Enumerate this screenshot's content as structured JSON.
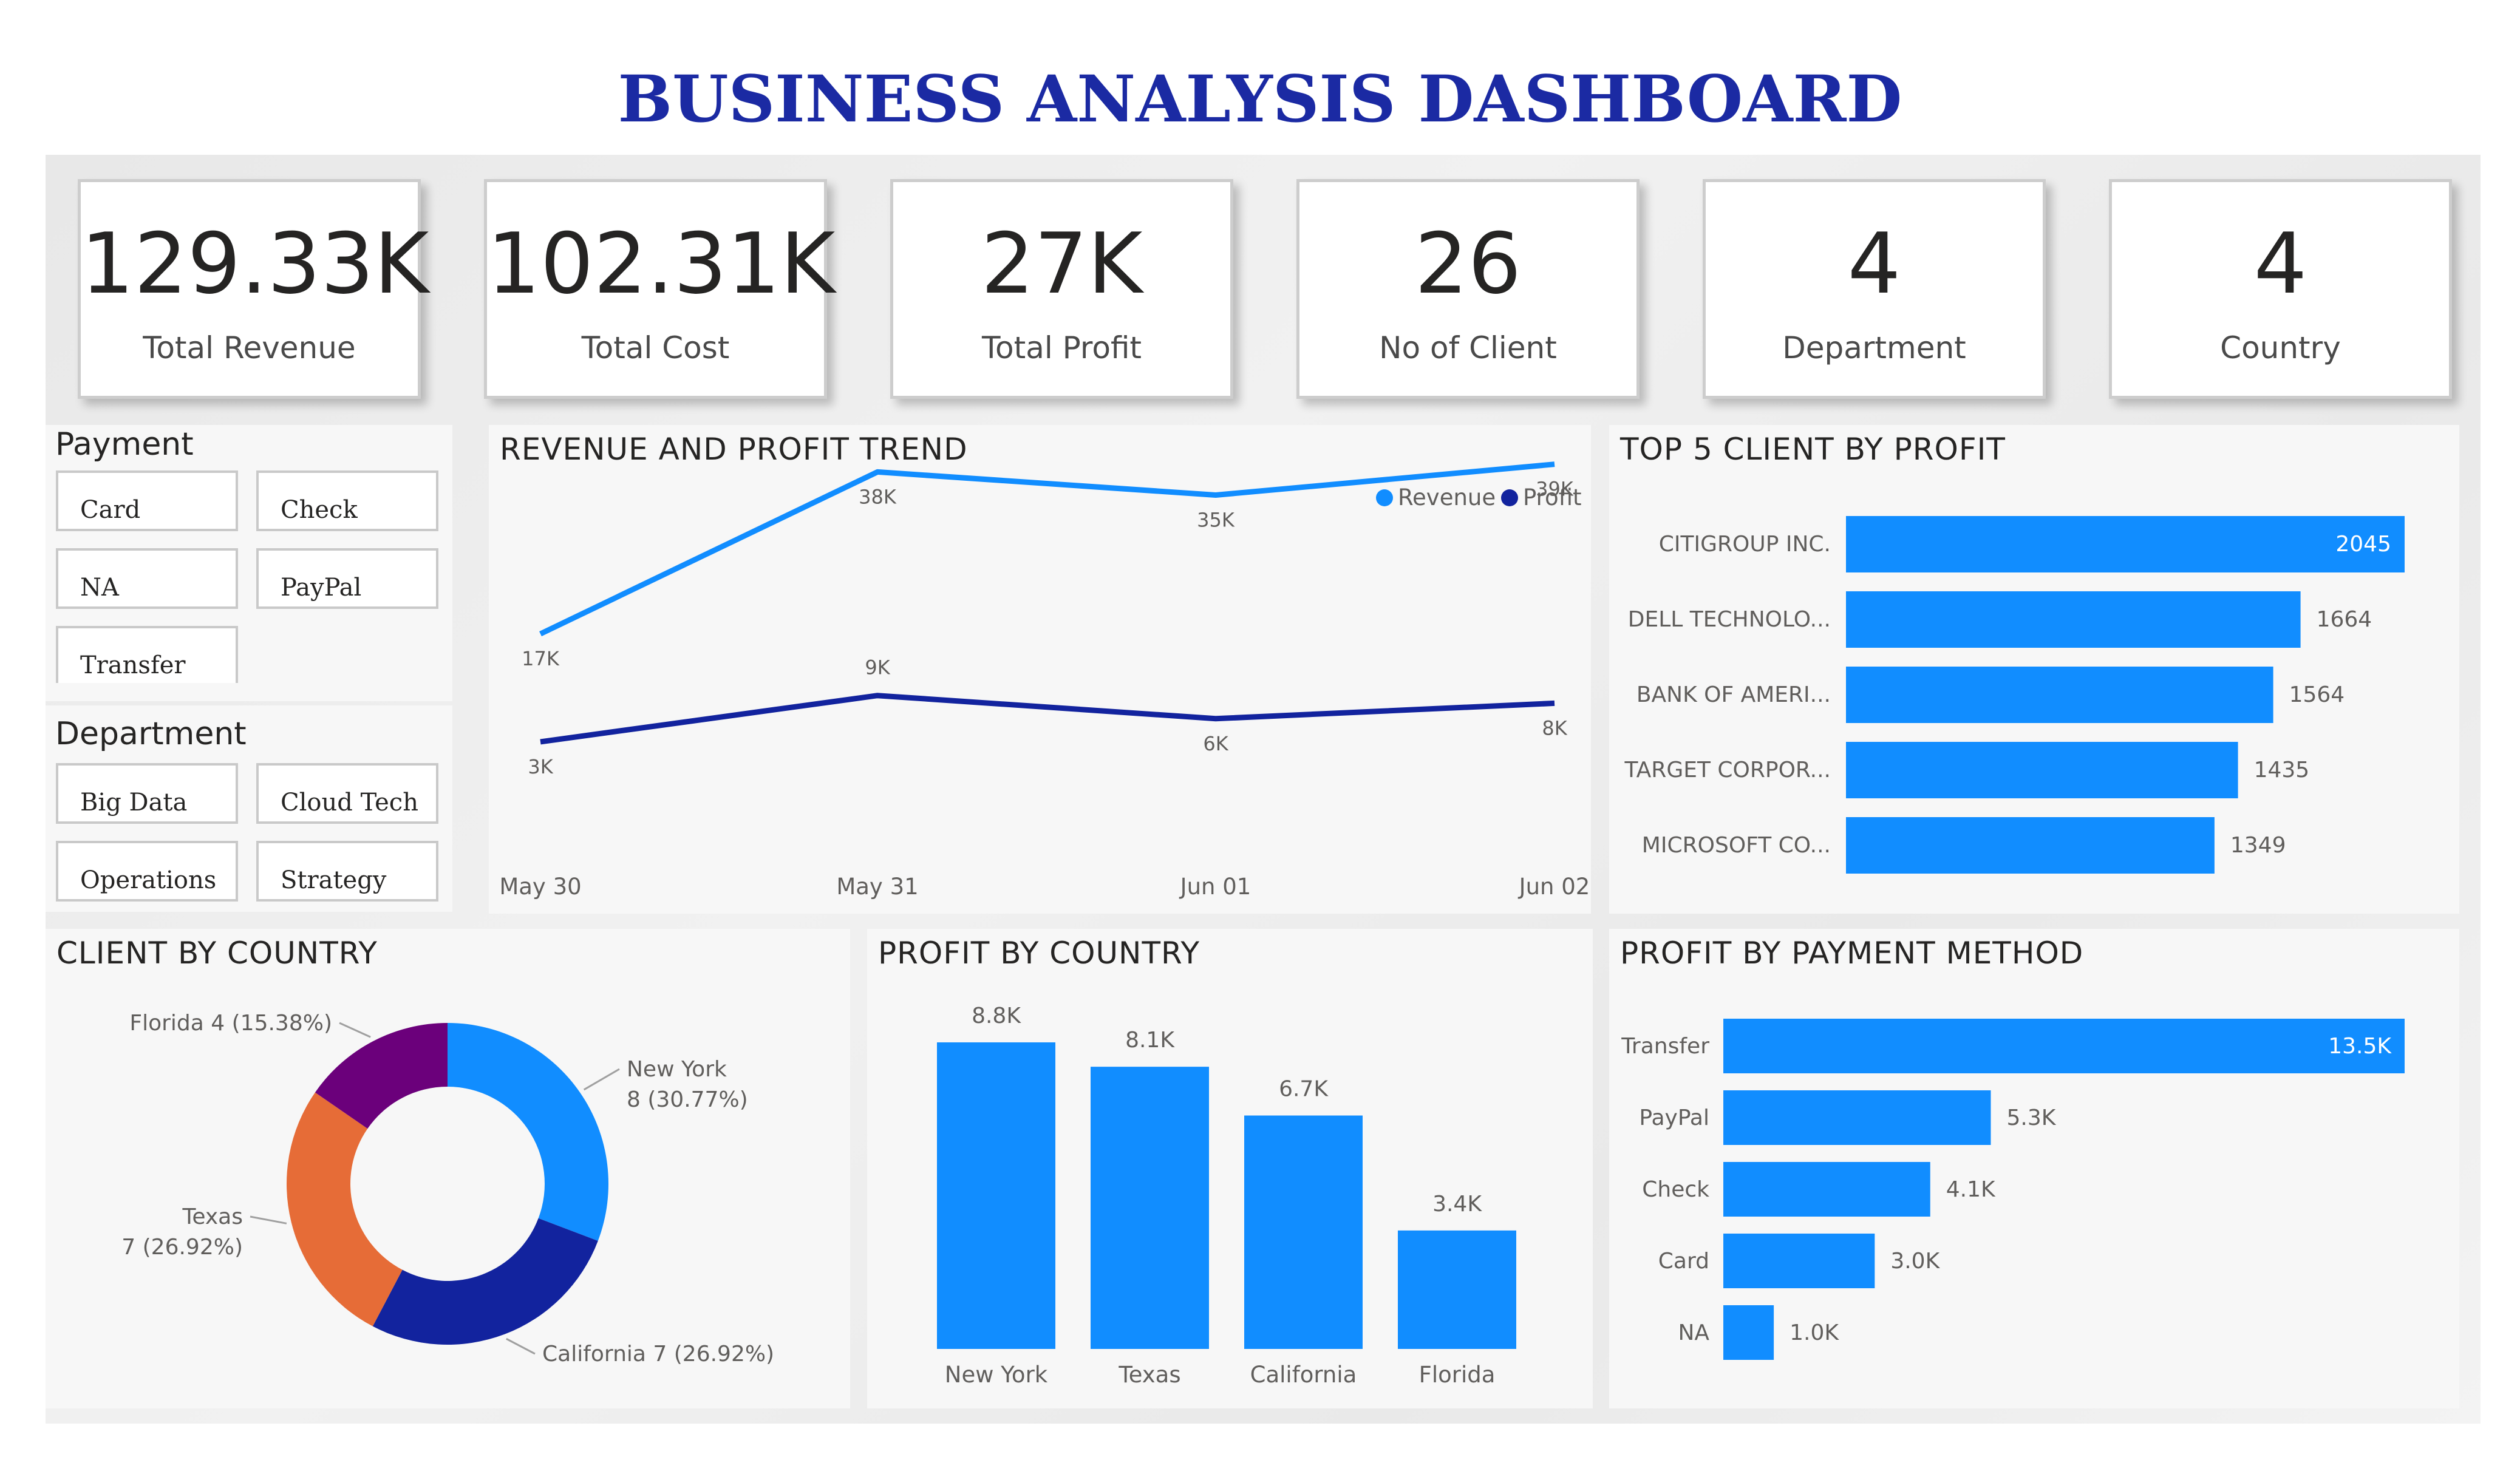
{
  "title": "BUSINESS ANALYSIS DASHBOARD",
  "colors": {
    "title": "#1b2aa3",
    "bar": "#118dff",
    "revenue": "#118dff",
    "profit": "#12239e",
    "orange": "#e66c37",
    "purple": "#6b007b"
  },
  "kpis": [
    {
      "value": "129.33K",
      "label": "Total Revenue"
    },
    {
      "value": "102.31K",
      "label": "Total Cost"
    },
    {
      "value": "27K",
      "label": "Total Profit"
    },
    {
      "value": "26",
      "label": "No of Client"
    },
    {
      "value": "4",
      "label": "Department"
    },
    {
      "value": "4",
      "label": "Country"
    }
  ],
  "payment_slicer": {
    "title": "Payment",
    "options": [
      "Card",
      "Check",
      "NA",
      "PayPal",
      "Transfer"
    ]
  },
  "department_slicer": {
    "title": "Department",
    "options": [
      "Big Data",
      "Cloud Tech",
      "Operations",
      "Strategy"
    ]
  },
  "chart_data": [
    {
      "id": "trend",
      "type": "line",
      "title": "REVENUE AND PROFIT TREND",
      "categories": [
        "May 30",
        "May 31",
        "Jun 01",
        "Jun 02"
      ],
      "series": [
        {
          "name": "Revenue",
          "values": [
            17,
            38,
            35,
            39
          ],
          "labels": [
            "17K",
            "38K",
            "35K",
            "39K"
          ],
          "color": "#118dff"
        },
        {
          "name": "Profit",
          "values": [
            3,
            9,
            6,
            8
          ],
          "labels": [
            "3K",
            "9K",
            "6K",
            "8K"
          ],
          "color": "#12239e"
        }
      ],
      "legend": "top-right",
      "unit": "K"
    },
    {
      "id": "top_clients",
      "type": "bar",
      "orientation": "horizontal",
      "title": "TOP 5 CLIENT BY PROFIT",
      "categories": [
        "CITIGROUP INC.",
        "DELL TECHNOLO...",
        "BANK OF AMERI...",
        "TARGET CORPOR...",
        "MICROSOFT CO..."
      ],
      "values": [
        2045,
        1664,
        1564,
        1435,
        1349
      ],
      "labels": [
        "2045",
        "1664",
        "1564",
        "1435",
        "1349"
      ],
      "xlim": [
        0,
        2045
      ]
    },
    {
      "id": "client_country",
      "type": "pie",
      "title": "CLIENT BY COUNTRY",
      "categories": [
        "New York",
        "California",
        "Texas",
        "Florida"
      ],
      "values": [
        8,
        7,
        7,
        4
      ],
      "labels": [
        [
          "New York",
          "8 (30.77%)"
        ],
        [
          "California 7 (26.92%)"
        ],
        [
          "Texas",
          "7 (26.92%)"
        ],
        [
          "Florida 4 (15.38%)"
        ]
      ],
      "colors": [
        "#118dff",
        "#12239e",
        "#e66c37",
        "#6b007b"
      ]
    },
    {
      "id": "profit_country",
      "type": "bar",
      "title": "PROFIT BY COUNTRY",
      "categories": [
        "New York",
        "Texas",
        "California",
        "Florida"
      ],
      "values": [
        8.8,
        8.1,
        6.7,
        3.4
      ],
      "labels": [
        "8.8K",
        "8.1K",
        "6.7K",
        "3.4K"
      ],
      "ylim": [
        0,
        8.8
      ]
    },
    {
      "id": "profit_payment",
      "type": "bar",
      "orientation": "horizontal",
      "title": "PROFIT BY PAYMENT METHOD",
      "categories": [
        "Transfer",
        "PayPal",
        "Check",
        "Card",
        "NA"
      ],
      "values": [
        13.5,
        5.3,
        4.1,
        3.0,
        1.0
      ],
      "labels": [
        "13.5K",
        "5.3K",
        "4.1K",
        "3.0K",
        "1.0K"
      ],
      "xlim": [
        0,
        13.5
      ]
    }
  ]
}
